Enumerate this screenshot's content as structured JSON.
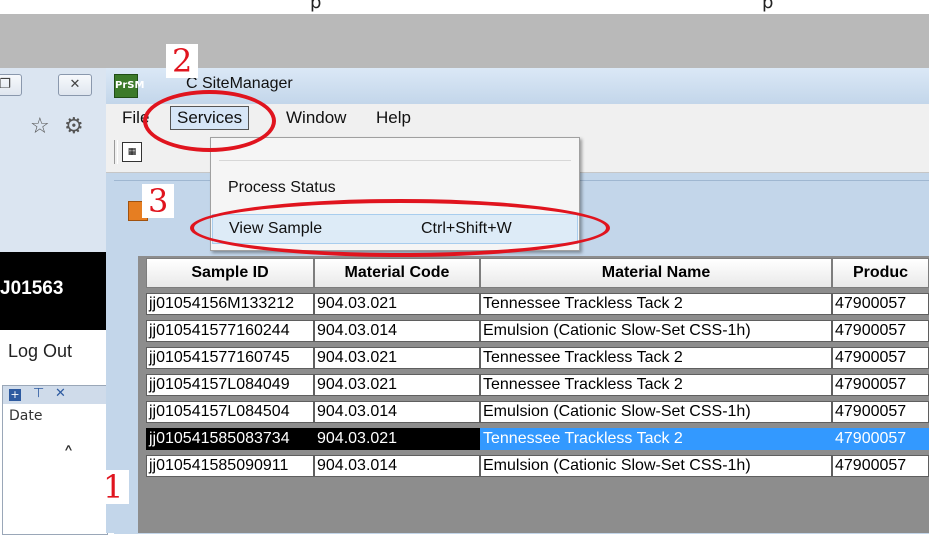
{
  "top_strip": {
    "text_left": "p",
    "text_right": "p"
  },
  "left_window": {
    "restore_icon": "restore-icon",
    "close_icon": "close-icon",
    "star_icon": "star-icon",
    "gear_icon": "gear-icon",
    "black_banner_text": "J01563",
    "logout_label": "Log Out",
    "panel_date_label": "Date",
    "panel_icons": [
      "plus-icon",
      "pin-icon",
      "close-icon"
    ]
  },
  "app": {
    "title": "C SiteManager",
    "menu": {
      "file": "File",
      "services": "Services",
      "window": "Window",
      "help": "Help"
    },
    "dropdown": {
      "process_status": "Process Status",
      "view_sample": "View Sample",
      "view_sample_shortcut": "Ctrl+Shift+W"
    }
  },
  "annotations": {
    "step1": "1",
    "step2": "2",
    "step3": "3",
    "color": "#e0141e"
  },
  "table": {
    "columns": [
      "Sample ID",
      "Material Code",
      "Material Name",
      "Produc"
    ],
    "rows": [
      [
        "jj01054156M133212",
        "904.03.021",
        "Tennessee Trackless Tack 2",
        "47900057"
      ],
      [
        "jj010541577160244",
        "904.03.014",
        "Emulsion (Cationic Slow-Set CSS-1h)",
        "47900057"
      ],
      [
        "jj010541577160745",
        "904.03.021",
        "Tennessee Trackless Tack 2",
        "47900057"
      ],
      [
        "jj01054157L084049",
        "904.03.021",
        "Tennessee Trackless Tack 2",
        "47900057"
      ],
      [
        "jj01054157L084504",
        "904.03.014",
        "Emulsion (Cationic Slow-Set CSS-1h)",
        "47900057"
      ],
      [
        "jj010541585083734",
        "904.03.021",
        "Tennessee Trackless Tack 2",
        "47900057"
      ],
      [
        "jj010541585090911",
        "904.03.014",
        "Emulsion (Cationic Slow-Set CSS-1h)",
        "47900057"
      ]
    ],
    "selected_row_index": 5
  }
}
